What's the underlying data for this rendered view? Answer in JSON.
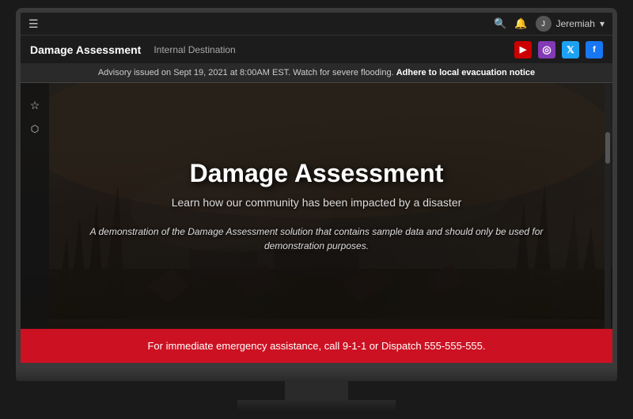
{
  "system_bar": {
    "search_icon": "🔍",
    "bell_icon": "🔔",
    "user": {
      "name": "Jeremiah",
      "avatar_initials": "J",
      "dropdown_icon": "▾"
    }
  },
  "app_header": {
    "title": "Damage Assessment",
    "subtitle": "Internal Destination",
    "social": {
      "youtube_label": "▶",
      "instagram_label": "◉",
      "twitter_label": "✦",
      "facebook_label": "f"
    }
  },
  "advisory": {
    "text": "Advisory issued on Sept 19, 2021 at 8:00AM EST. Watch for severe flooding.",
    "bold_text": "Adhere to local evacuation notice"
  },
  "hero": {
    "title": "Damage Assessment",
    "subtitle": "Learn how our community has been impacted by a disaster",
    "demo_text": "A demonstration of the Damage Assessment solution that contains sample data and should only be used for demonstration purposes."
  },
  "sidebar": {
    "star_icon": "☆",
    "share_icon": "⬛"
  },
  "emergency_banner": {
    "text": "For immediate emergency assistance, call 9-1-1 or Dispatch 555-555-555."
  }
}
